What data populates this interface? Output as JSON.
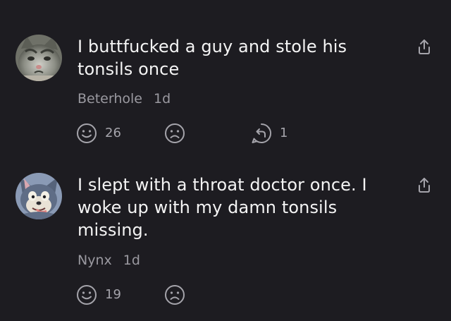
{
  "colors": {
    "background": "#1d1c21",
    "text": "#f4f4f4",
    "meta": "#9a99a0",
    "icon": "#a5a4ab"
  },
  "comments": [
    {
      "text": "I buttfucked a guy and stole his tonsils once",
      "author": "Beterhole",
      "age": "1d",
      "likes": "26",
      "replies": "1",
      "avatar_icon": "cat-avatar-icon"
    },
    {
      "text": "I slept with a throat doctor once. I woke up with my damn tonsils missing.",
      "author": "Nynx",
      "age": "1d",
      "likes": "19",
      "avatar_icon": "tom-cat-avatar-icon"
    }
  ]
}
